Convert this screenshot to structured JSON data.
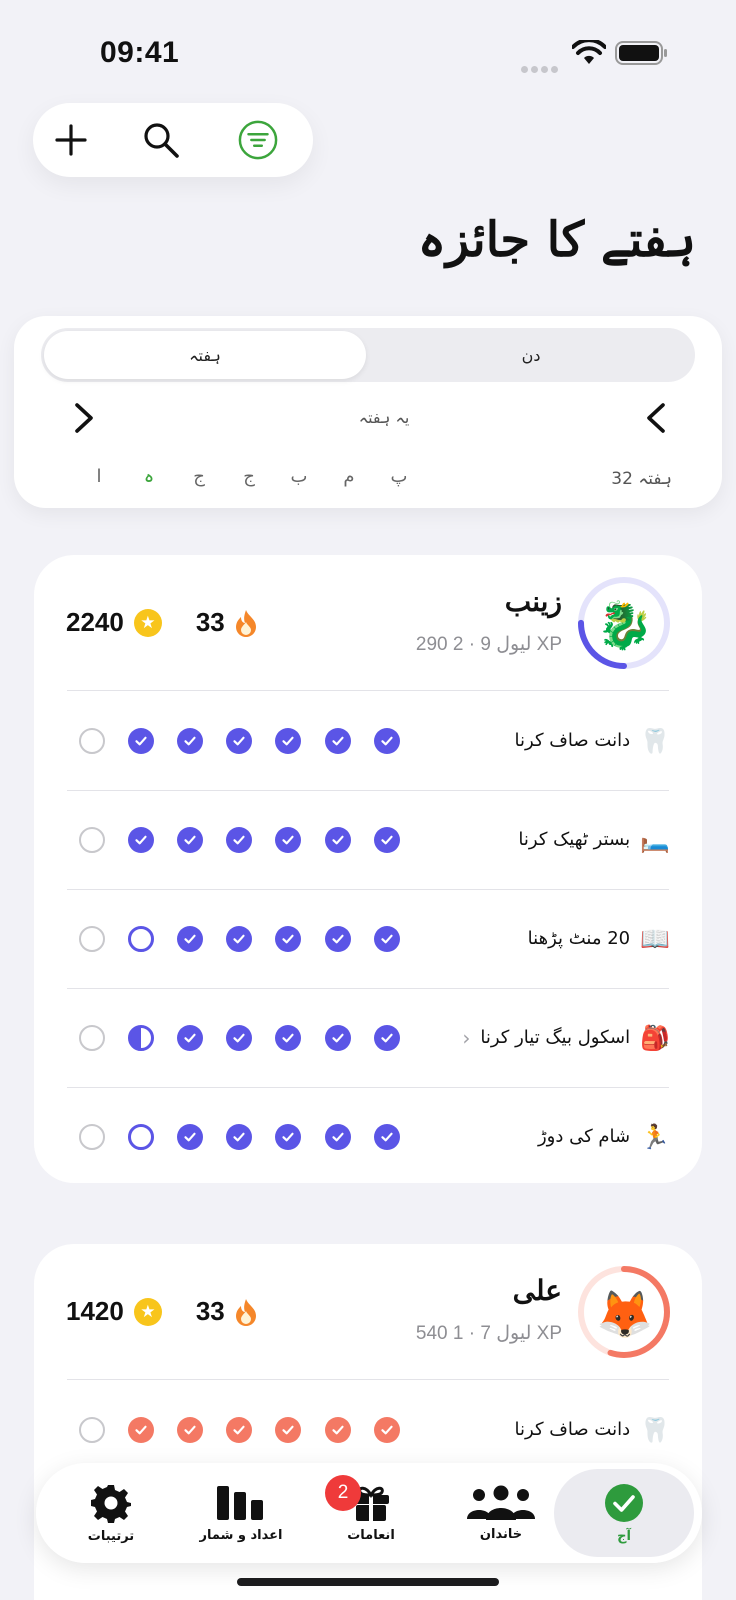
{
  "status": {
    "time": "09:41"
  },
  "toolbar": {
    "icons": [
      "plus-icon",
      "search-icon",
      "filter-icon"
    ]
  },
  "page": {
    "title": "ہفتے کا جائزہ"
  },
  "segment": {
    "week": "ہفتہ",
    "day": "دن",
    "selected": "week"
  },
  "week": {
    "label": "یہ ہفتہ",
    "number": "ہفتہ 32",
    "days": [
      "ا",
      "ہ",
      "ج",
      "ج",
      "ب",
      "م",
      "پ"
    ],
    "today_index": 1
  },
  "people": [
    {
      "name": "زینب",
      "level": "لیول 9 · 2 290 XP",
      "avatar": "🐉",
      "ring_color": "#5b55e6",
      "ring_progress": 0.25,
      "coins": "2240",
      "streak": "33",
      "tasks": [
        {
          "emoji": "🦷",
          "label": "دانت صاف کرنا",
          "chevron": false,
          "states": [
            "empty",
            "done",
            "done",
            "done",
            "done",
            "done",
            "done"
          ]
        },
        {
          "emoji": "🛏️",
          "label": "بستر ٹھیک کرنا",
          "chevron": false,
          "states": [
            "empty",
            "done",
            "done",
            "done",
            "done",
            "done",
            "done"
          ]
        },
        {
          "emoji": "📖",
          "label": "20 منٹ پڑھنا",
          "chevron": false,
          "states": [
            "empty",
            "ring",
            "done",
            "done",
            "done",
            "done",
            "done"
          ]
        },
        {
          "emoji": "🎒",
          "label": "اسکول بیگ تیار کرنا",
          "chevron": true,
          "states": [
            "empty",
            "half",
            "done",
            "done",
            "done",
            "done",
            "done"
          ]
        },
        {
          "emoji": "🏃",
          "label": "شام کی دوڑ",
          "chevron": false,
          "states": [
            "empty",
            "ring",
            "done",
            "done",
            "done",
            "done",
            "done"
          ]
        }
      ]
    },
    {
      "name": "علی",
      "level": "لیول 7 · 1 540 XP",
      "avatar": "🦊",
      "ring_color": "#f47964",
      "ring_progress": 0.55,
      "coins": "1420",
      "streak": "33",
      "tasks": [
        {
          "emoji": "🦷",
          "label": "دانت صاف کرنا",
          "chevron": false,
          "states": [
            "empty",
            "done",
            "done",
            "done",
            "done",
            "done",
            "done"
          ]
        }
      ]
    }
  ],
  "tabs": [
    {
      "label": "ترتیبات",
      "icon": "gear-icon"
    },
    {
      "label": "اعداد و شمار",
      "icon": "chart-icon"
    },
    {
      "label": "انعامات",
      "icon": "gift-icon",
      "badge": "2"
    },
    {
      "label": "خاندان",
      "icon": "people-icon"
    },
    {
      "label": "آج",
      "icon": "check-circle-icon",
      "active": true
    }
  ]
}
